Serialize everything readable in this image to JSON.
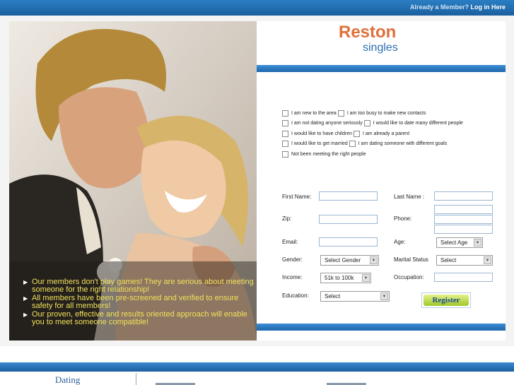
{
  "header": {
    "member_prompt": "Already a Member?",
    "login_link": "Log in Here"
  },
  "brand": {
    "name": "Reston",
    "tagline": "singles"
  },
  "promo": {
    "bullets": [
      "Our members don't play games! They are serious about meeting someone for the right relationship!",
      "All members have been pre-screened and verified to ensure safety for all members!",
      "Our proven, effective and results oriented approach will enable you to meet someone compatible!"
    ]
  },
  "reasons": {
    "lines": [
      [
        "I am new to the area",
        "I am too busy to make new contacts"
      ],
      [
        "I am not dating anyone seriously",
        "I would like to date many different people"
      ],
      [
        "I would like to have children",
        "I am already a parent"
      ],
      [
        "I would like to get married",
        "I am dating someone with different goals"
      ],
      [
        "Not been meeting the right people"
      ]
    ]
  },
  "form": {
    "first_name_label": "First Name:",
    "last_name_label": "Last Name :",
    "zip_label": "Zip:",
    "phone_label": "Phone:",
    "email_label": "Email:",
    "age_label": "Age:",
    "age_value": "Select Age",
    "gender_label": "Gender:",
    "gender_value": "Select Gender",
    "marital_label": "Marital Status",
    "marital_value": "Select",
    "income_label": "Income:",
    "income_value": "51k to 100k",
    "occupation_label": "Occupation:",
    "education_label": "Education:",
    "education_value": "Select",
    "register_label": "Register"
  },
  "footer": {
    "section_title": "Dating"
  },
  "colors": {
    "brand_orange": "#e0703a",
    "brand_blue": "#2e6fb2",
    "bullet_yellow": "#f2e05a",
    "register_green": "#9fc72a"
  }
}
